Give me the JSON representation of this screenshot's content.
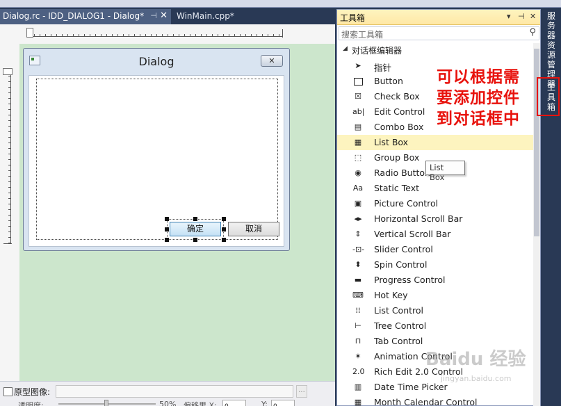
{
  "doc_tabs": {
    "active_label": "Dialog.rc - IDD_DIALOG1 - Dialog*",
    "pin_glyph": "⊣",
    "close_glyph": "✕",
    "other_label": "WinMain.cpp*"
  },
  "dialog": {
    "title": "Dialog",
    "close_glyph": "✕",
    "ok_label": "确定",
    "cancel_label": "取消"
  },
  "bottom": {
    "checkbox_label": "原型图像:",
    "browse_label": "...",
    "opacity_label": "透明度:",
    "opacity_value": "50%",
    "offset_label": "偏移里 X:",
    "offset_x": "0",
    "y_label": "Y:",
    "offset_y": "0"
  },
  "toolbox": {
    "title": "工具箱",
    "search_placeholder": "搜索工具箱",
    "search_glyph": "⚲",
    "category": "对话框编辑器",
    "header_buttons": [
      "▾",
      "⊣",
      "✕"
    ],
    "items": [
      {
        "label": "指针",
        "icon": "pointer-icon",
        "glyph": "➤"
      },
      {
        "label": "Button",
        "icon": "button-icon",
        "glyph": ""
      },
      {
        "label": "Check Box",
        "icon": "check-box-icon",
        "glyph": "☒"
      },
      {
        "label": "Edit Control",
        "icon": "edit-control-icon",
        "glyph": "ab|"
      },
      {
        "label": "Combo Box",
        "icon": "combo-box-icon",
        "glyph": "▤"
      },
      {
        "label": "List Box",
        "icon": "list-box-icon",
        "glyph": "▦"
      },
      {
        "label": "Group Box",
        "icon": "group-box-icon",
        "glyph": "⬚"
      },
      {
        "label": "Radio Button",
        "icon": "radio-button-icon",
        "glyph": "◉"
      },
      {
        "label": "Static Text",
        "icon": "static-text-icon",
        "glyph": "Aa"
      },
      {
        "label": "Picture Control",
        "icon": "picture-control-icon",
        "glyph": "▣"
      },
      {
        "label": "Horizontal Scroll Bar",
        "icon": "horizontal-scroll-bar-icon",
        "glyph": "◂▸"
      },
      {
        "label": "Vertical Scroll Bar",
        "icon": "vertical-scroll-bar-icon",
        "glyph": "⇕"
      },
      {
        "label": "Slider Control",
        "icon": "slider-control-icon",
        "glyph": "-⊡-"
      },
      {
        "label": "Spin Control",
        "icon": "spin-control-icon",
        "glyph": "⬍"
      },
      {
        "label": "Progress Control",
        "icon": "progress-control-icon",
        "glyph": "▬"
      },
      {
        "label": "Hot Key",
        "icon": "hot-key-icon",
        "glyph": "⌨"
      },
      {
        "label": "List Control",
        "icon": "list-control-icon",
        "glyph": "⁞⁞"
      },
      {
        "label": "Tree Control",
        "icon": "tree-control-icon",
        "glyph": "⊢"
      },
      {
        "label": "Tab Control",
        "icon": "tab-control-icon",
        "glyph": "⊓"
      },
      {
        "label": "Animation Control",
        "icon": "animation-control-icon",
        "glyph": "✶"
      },
      {
        "label": "Rich Edit 2.0 Control",
        "icon": "rich-edit-icon",
        "glyph": "2.0"
      },
      {
        "label": "Date Time Picker",
        "icon": "date-time-picker-icon",
        "glyph": "▥"
      },
      {
        "label": "Month Calendar Control",
        "icon": "month-calendar-icon",
        "glyph": "▦"
      }
    ],
    "highlighted_index": 5
  },
  "tooltip": {
    "text": "List Box"
  },
  "annotation": {
    "lines": [
      "可以根据需",
      "要添加控件",
      "到对话框中"
    ]
  },
  "watermark": {
    "main": "Baidu 经验",
    "sub": "jingyan.baidu.com"
  },
  "side_tabs": {
    "server_explorer": "服务器资源管理器",
    "toolbox": "工具箱"
  },
  "colors": {
    "annotation_red": "#e8120c",
    "highlight_yellow": "#fdf4bf",
    "designer_green": "#cce6cc",
    "ide_navy": "#293955"
  }
}
